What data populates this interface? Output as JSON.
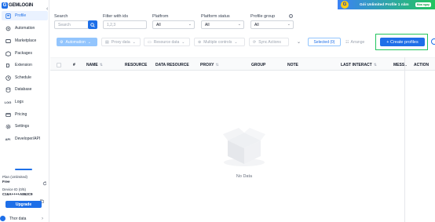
{
  "app": {
    "logo_text": "GEMLOGIN"
  },
  "sidebar": {
    "items": [
      {
        "label": "Profile",
        "icon": "profile-icon",
        "active": true
      },
      {
        "label": "Automation",
        "icon": "automation-icon"
      },
      {
        "label": "Marketplace",
        "icon": "marketplace-icon"
      },
      {
        "label": "Packages",
        "icon": "packages-icon"
      },
      {
        "label": "Extension",
        "icon": "extension-icon"
      },
      {
        "label": "Schedule",
        "icon": "schedule-icon"
      },
      {
        "label": "Database",
        "icon": "database-icon"
      },
      {
        "label": "Logs",
        "icon": "logs-icon"
      },
      {
        "label": "Pricing",
        "icon": "pricing-icon"
      },
      {
        "label": "Settings",
        "icon": "settings-icon"
      },
      {
        "label": "Developer/API",
        "icon": "api-icon"
      }
    ],
    "plan_title": "Plan (Unlimited)",
    "plan_value": "Free",
    "device_title": "Device ID (0/5)",
    "device_value": "C16A++++A862C9",
    "upgrade_label": "Upgrade",
    "user_name": "Thor data"
  },
  "banner": {
    "text": "Gói Unlimited Profile 1 năm",
    "button": "Mua ngay"
  },
  "filters": {
    "search_label": "Search",
    "search_placeholder": "Search",
    "filter_ids_label": "Filter with ids",
    "filter_ids_placeholder": "1,2,3",
    "platform_label": "Platfrom",
    "platform_value": "All",
    "platform_status_label": "Platform status",
    "platform_status_value": "All",
    "profile_group_label": "Profile group",
    "profile_group_value": "All"
  },
  "toolbar": {
    "automation": "Automation",
    "proxy_data": "Proxy data",
    "resource_data": "Resource data",
    "multiple_controls": "Multiple controls",
    "sync_actions": "Sync Actions",
    "selected": "Selected (0)",
    "arrange": "Arrange",
    "create_profiles": "+ Create profiles"
  },
  "table": {
    "columns": [
      "#",
      "NAME",
      "RESOURCE",
      "DATA RESOURCE",
      "PROXY",
      "GROUP",
      "NOTE",
      "LAST INTERACT",
      "MESS..",
      "ACTION"
    ],
    "sort_glyph": "⇅",
    "rows": [],
    "empty_text": "No Data"
  },
  "colors": {
    "accent": "#1e6fe8",
    "highlight": "#22c55e"
  }
}
